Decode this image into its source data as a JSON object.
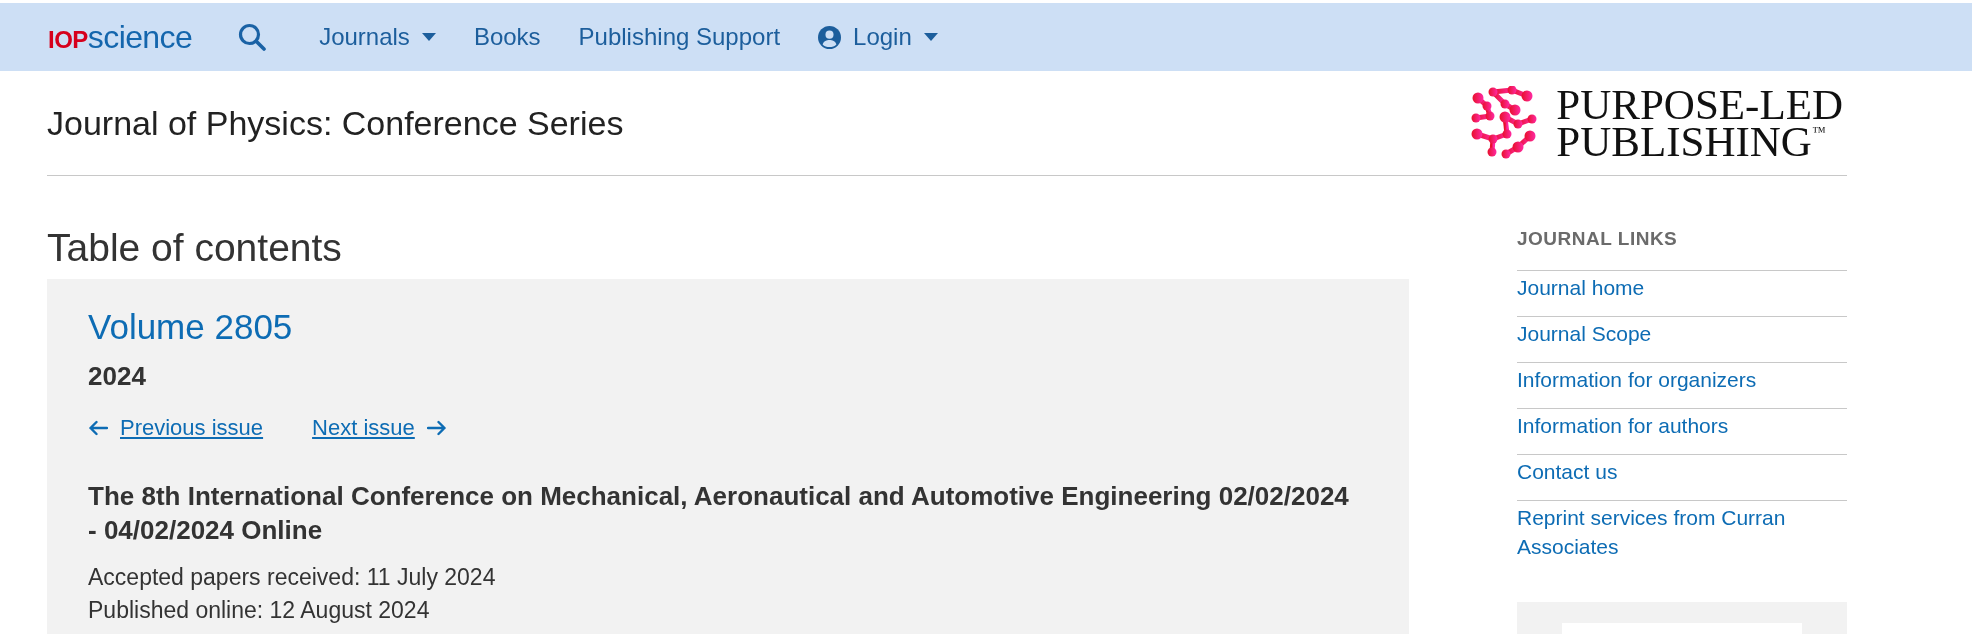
{
  "header": {
    "logo": {
      "mark": "IOP",
      "name": "science"
    },
    "nav": [
      {
        "label": "Journals",
        "kind": "dropdown"
      },
      {
        "label": "Books",
        "kind": "link"
      },
      {
        "label": "Publishing Support",
        "kind": "link"
      },
      {
        "label": "Login",
        "kind": "account"
      }
    ]
  },
  "journal": {
    "title": "Journal of Physics: Conference Series",
    "publisher_logo": {
      "lines": [
        "PURPOSE-LED",
        "PUBLISHING$^{™}$"
      ]
    }
  },
  "toc": {
    "heading": "Table of contents",
    "volume": "Volume 2805",
    "year": "2024",
    "previous": "Previous issue",
    "next": "Next issue",
    "conference": "The 8th International Conference on Mechanical, Aeronautical and Automotive Engineering 02/02/2024 - 04/02/2024 Online",
    "dates": [
      "Accepted papers received: 11 July 2024",
      "Published online: 12 August 2024"
    ]
  },
  "sidebar": {
    "heading": "JOURNAL LINKS",
    "links": [
      "Journal home",
      "Journal Scope",
      "Information for organizers",
      "Information for authors",
      "Contact us",
      "Reprint services from Curran Associates"
    ]
  }
}
